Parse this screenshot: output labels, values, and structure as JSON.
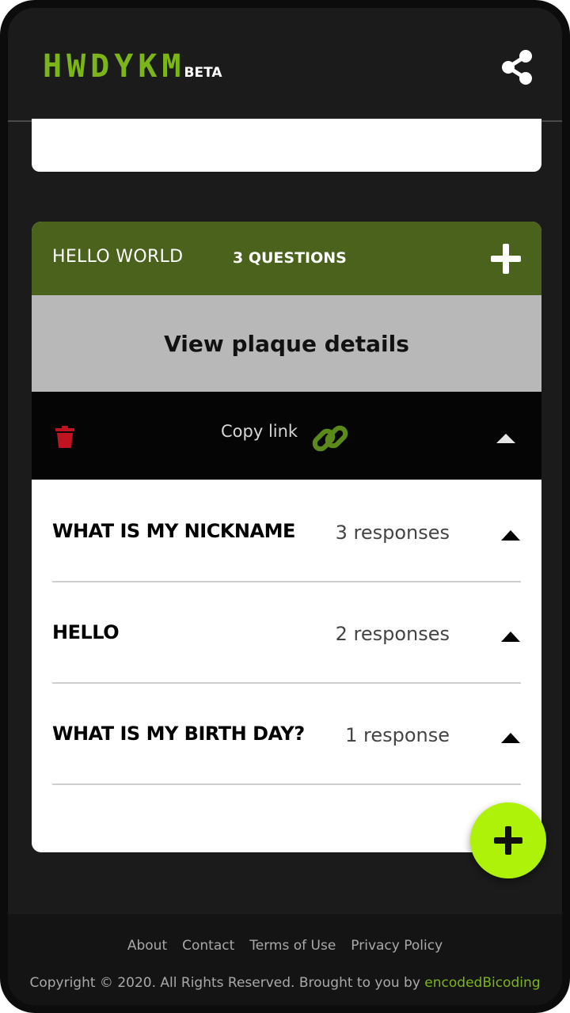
{
  "header": {
    "logo": "HWDYKM",
    "badge": "BETA",
    "share_icon": "share-icon",
    "accent_color": "#7cb518"
  },
  "plaque": {
    "title": "HELLO WORLD",
    "question_count": "3 QUESTIONS",
    "add_icon": "plus-icon",
    "header_color": "#4a621b",
    "view_details_label": "View plaque details",
    "copy_link_label": "Copy link",
    "delete_icon": "trash-icon",
    "link_icon": "link-icon",
    "collapse_icon": "caret-up-icon"
  },
  "questions": [
    {
      "text": "WHAT IS MY NICKNAME",
      "responses": "3 responses"
    },
    {
      "text": "HELLO",
      "responses": "2 responses"
    },
    {
      "text": "WHAT IS MY BIRTH DAY?",
      "responses": "1 response"
    }
  ],
  "fab": {
    "icon": "plus-icon",
    "color": "#aef20a"
  },
  "footer": {
    "links": [
      "About",
      "Contact",
      "Terms of Use",
      "Privacy Policy"
    ],
    "copyright_prefix": "Copyright © 2020. All Rights Reserved. Brought to you by",
    "brand": "encodedBicoding"
  }
}
